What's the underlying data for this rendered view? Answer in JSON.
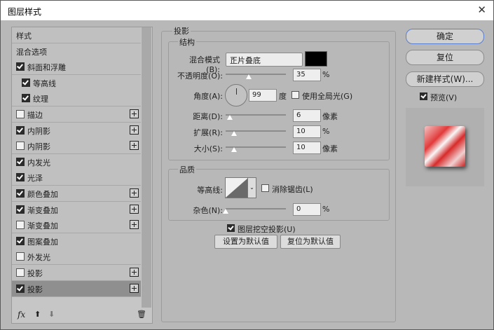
{
  "dialog": {
    "title": "图层样式",
    "close": "✕"
  },
  "left_panel": {
    "items": [
      {
        "label": "样式",
        "checkbox": false,
        "checked": false,
        "plus": false,
        "indent": false
      },
      {
        "label": "混合选项",
        "checkbox": false,
        "checked": false,
        "plus": false,
        "indent": false
      },
      {
        "label": "斜面和浮雕",
        "checkbox": true,
        "checked": true,
        "plus": false,
        "indent": false
      },
      {
        "label": "等高线",
        "checkbox": true,
        "checked": true,
        "plus": false,
        "indent": true
      },
      {
        "label": "纹理",
        "checkbox": true,
        "checked": true,
        "plus": false,
        "indent": true
      },
      {
        "label": "描边",
        "checkbox": true,
        "checked": false,
        "plus": true,
        "indent": false
      },
      {
        "label": "内阴影",
        "checkbox": true,
        "checked": true,
        "plus": true,
        "indent": false
      },
      {
        "label": "内阴影",
        "checkbox": true,
        "checked": false,
        "plus": true,
        "indent": false
      },
      {
        "label": "内发光",
        "checkbox": true,
        "checked": true,
        "plus": false,
        "indent": false
      },
      {
        "label": "光泽",
        "checkbox": true,
        "checked": true,
        "plus": false,
        "indent": false
      },
      {
        "label": "颜色叠加",
        "checkbox": true,
        "checked": true,
        "plus": true,
        "indent": false
      },
      {
        "label": "渐变叠加",
        "checkbox": true,
        "checked": true,
        "plus": true,
        "indent": false
      },
      {
        "label": "渐变叠加",
        "checkbox": true,
        "checked": false,
        "plus": true,
        "indent": false
      },
      {
        "label": "图案叠加",
        "checkbox": true,
        "checked": true,
        "plus": false,
        "indent": false
      },
      {
        "label": "外发光",
        "checkbox": true,
        "checked": false,
        "plus": false,
        "indent": false
      },
      {
        "label": "投影",
        "checkbox": true,
        "checked": false,
        "plus": true,
        "indent": false
      },
      {
        "label": "投影",
        "checkbox": true,
        "checked": true,
        "plus": true,
        "indent": false,
        "selected": true
      }
    ],
    "bottom": {
      "fx": "fx",
      "up": "⬆",
      "down": "⬇",
      "trash": "🗑"
    }
  },
  "shadow": {
    "section_title": "投影",
    "structure_title": "结构",
    "blend_mode_label": "混合模式(B):",
    "blend_mode_value": "正片叠底",
    "opacity_label": "不透明度(O):",
    "opacity_value": "35",
    "opacity_unit": "%",
    "angle_label": "角度(A):",
    "angle_value": "99",
    "angle_unit": "度",
    "global_light_label": "使用全局光(G)",
    "distance_label": "距离(D):",
    "distance_value": "6",
    "distance_unit": "像素",
    "spread_label": "扩展(R):",
    "spread_value": "10",
    "spread_unit": "%",
    "size_label": "大小(S):",
    "size_value": "10",
    "size_unit": "像素",
    "quality_title": "品质",
    "contour_label": "等高线:",
    "antialias_label": "消除锯齿(L)",
    "noise_label": "杂色(N):",
    "noise_value": "0",
    "noise_unit": "%",
    "knockout_label": "图层挖空投影(U)",
    "set_default": "设置为默认值",
    "reset_default": "复位为默认值"
  },
  "right": {
    "ok": "确定",
    "reset": "复位",
    "new_style": "新建样式(W)...",
    "preview_label": "预览(V)"
  }
}
